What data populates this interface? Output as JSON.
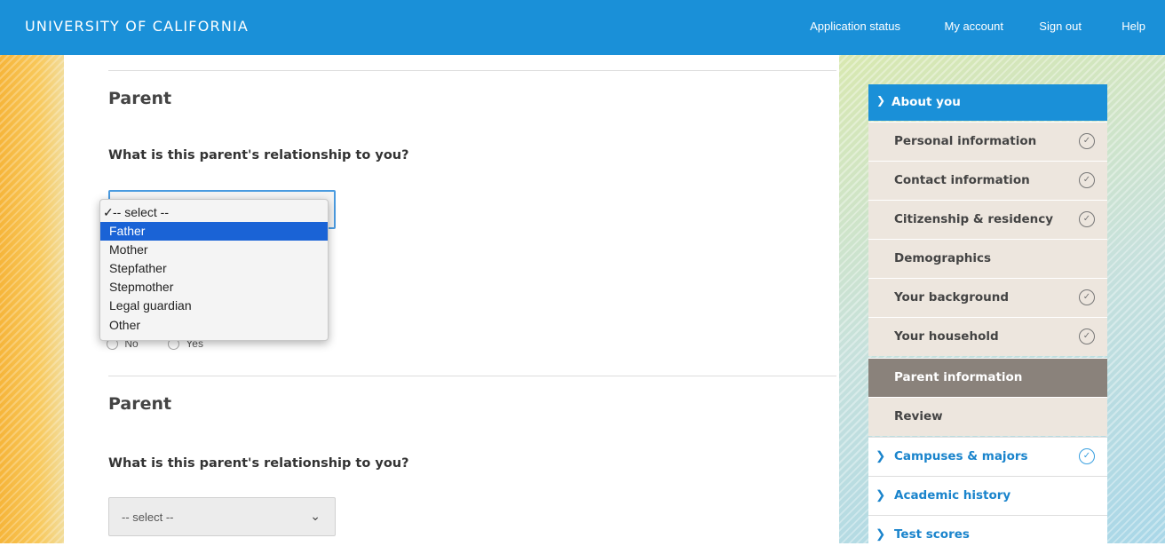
{
  "header": {
    "brand": "UNIVERSITY OF CALIFORNIA",
    "nav": [
      "Application status",
      "My account",
      "Sign out",
      "Help"
    ],
    "color": "#1a90d8"
  },
  "form": {
    "sections": [
      {
        "title": "Parent",
        "question": "What is this parent's relationship to you?",
        "select_value": "-- select --"
      },
      {
        "title": "Parent",
        "question": "What is this parent's relationship to you?",
        "select_value": "-- select --"
      }
    ],
    "radio_labels": [
      "No",
      "Yes"
    ],
    "dropdown_options": [
      "-- select --",
      "Father",
      "Mother",
      "Stepfather",
      "Stepmother",
      "Legal guardian",
      "Other"
    ],
    "dropdown_checked": "-- select --",
    "dropdown_highlighted": "Father"
  },
  "sidebar": {
    "heading": "About you",
    "items": [
      {
        "label": "Personal information",
        "done": true
      },
      {
        "label": "Contact information",
        "done": true
      },
      {
        "label": "Citizenship & residency",
        "done": true
      },
      {
        "label": "Demographics",
        "done": false
      },
      {
        "label": "Your background",
        "done": true
      },
      {
        "label": "Your household",
        "done": true
      },
      {
        "label": "Parent information",
        "done": false,
        "active": true
      },
      {
        "label": "Review",
        "done": false
      }
    ],
    "sub_sections": [
      {
        "label": "Campuses & majors",
        "done": true
      },
      {
        "label": "Academic history",
        "done": false
      },
      {
        "label": "Test scores",
        "done": false
      }
    ]
  }
}
